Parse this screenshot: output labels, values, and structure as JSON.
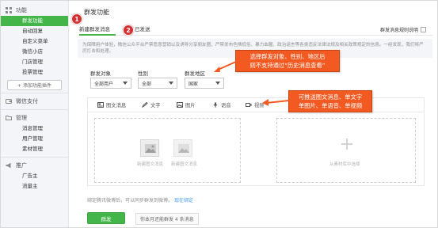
{
  "sidebar": {
    "section_features": "功能",
    "items_features": [
      "群发功能",
      "自动回复",
      "自定义菜单",
      "微信小店",
      "门店管理",
      "投票管理"
    ],
    "add_plugin": "+ 添加功能插件",
    "section_pay": "微信支付",
    "section_manage": "管理",
    "items_manage": [
      "消息管理",
      "用户管理",
      "素材管理"
    ],
    "section_promo": "推广",
    "items_promo": [
      "广告主",
      "流量主"
    ]
  },
  "main": {
    "title": "群发功能",
    "tabs": [
      "新建群发消息",
      "已发送"
    ],
    "rules_link": "群发消息规则说明",
    "notice": "为保障用户体验，微信公众平台严禁恶意营销以及诱导分享朋友圈，严禁发布色情低俗、暴力血腥、政治谣言等各类违反法律法规及相关政策规定的信息。一经发现，我们将严厉打击和处理。",
    "filters": {
      "target_label": "群发对象",
      "target_value": "全部用户",
      "gender_label": "性别",
      "gender_value": "全部",
      "region_label": "群发地区",
      "region_value": "国家"
    },
    "toolbar": [
      "图文消息",
      "文字",
      "图片",
      "语音",
      "视频"
    ],
    "cards": {
      "from_library": "从素材库中选择",
      "new_article": "新建图文消息",
      "multi_article": "新建图文消息",
      "new_material": "从素材库中选择"
    },
    "bind_text": "绑定腾讯微博后，可以同步群发到微博。",
    "bind_link": "现在绑定",
    "send_button": "群发",
    "quota": "你本月还能群发 4 条消息"
  },
  "annotations": {
    "badge1": "1",
    "badge2": "2",
    "callout_top": [
      "选择群发对象、性别、地区后",
      "则不支持通过“历史消息查看”"
    ],
    "callout_right": [
      "可推送图文消息、单文字",
      "单图片、单语音、单视频"
    ]
  },
  "colors": {
    "accent_green": "#44b549",
    "callout_orange": "#f25a22",
    "badge_red": "#d62f2f"
  }
}
